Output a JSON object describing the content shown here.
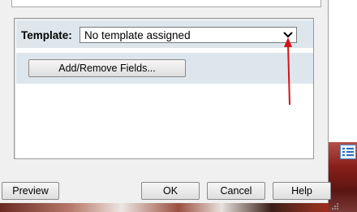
{
  "template": {
    "label": "Template:",
    "selected_value": "No template assigned",
    "dropdown_icon": "chevron-down-icon"
  },
  "fields": {
    "add_remove_label": "Add/Remove Fields..."
  },
  "footer": {
    "preview_label": "Preview",
    "ok_label": "OK",
    "cancel_label": "Cancel",
    "help_label": "Help"
  },
  "annotation": {
    "arrow_color": "#d0141a"
  },
  "colors": {
    "group_band": "#dde6ec",
    "dialog_bg": "#f0f0f0"
  }
}
